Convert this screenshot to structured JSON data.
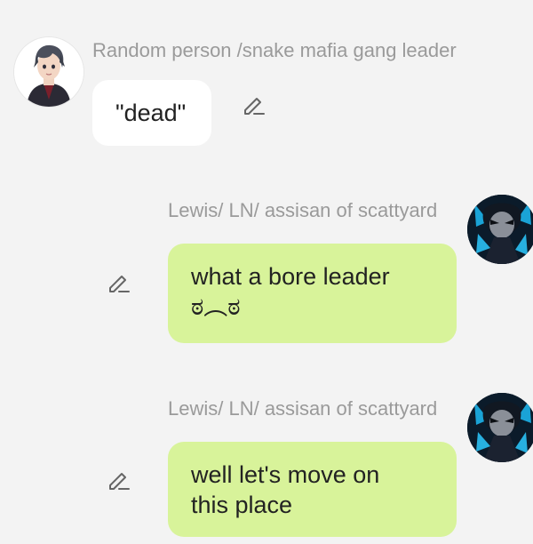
{
  "messages": [
    {
      "sender": "Random person /snake mafia gang leader",
      "text": "\"dead\"",
      "side": "left",
      "avatar_icon": "anime-man-avatar",
      "edit_icon": "pencil-icon"
    },
    {
      "sender": "Lewis/ LN/ assisan of scattyard",
      "text_lines": [
        "what a bore leader",
        "ಠ︵ಠ"
      ],
      "side": "right",
      "avatar_icon": "dark-blue-character-avatar",
      "edit_icon": "pencil-icon"
    },
    {
      "sender": "Lewis/ LN/ assisan of scattyard",
      "text_lines": [
        "well let's move on",
        "this place"
      ],
      "side": "right",
      "avatar_icon": "dark-blue-character-avatar",
      "edit_icon": "pencil-icon"
    }
  ],
  "colors": {
    "background": "#f3f3f3",
    "bubble_left": "#ffffff",
    "bubble_right": "#d8f39a",
    "name_text": "#9a9a9a",
    "message_text": "#222222"
  }
}
